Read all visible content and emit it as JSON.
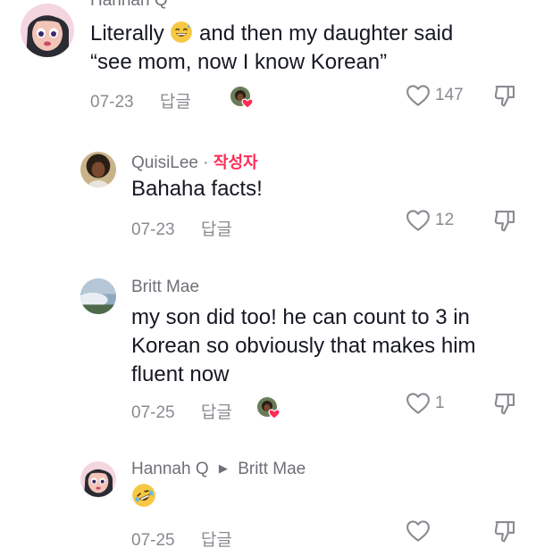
{
  "comments": [
    {
      "username": "Hannah Q",
      "text_prefix": "Literally",
      "text_suffix": "and then my daughter said",
      "text_line2": "“see mom, now I know Korean”",
      "date": "07-23",
      "reply_label": "답글",
      "likes": "147",
      "creator_liked": true
    },
    {
      "username": "QuisiLee",
      "separator": "·",
      "author_badge": "작성자",
      "text": "Bahaha facts!",
      "date": "07-23",
      "reply_label": "답글",
      "likes": "12",
      "creator_liked": false
    },
    {
      "username": "Britt Mae",
      "text_line1": "my son did too! he can count to 3 in",
      "text_line2": "Korean so obviously that makes him",
      "text_line3": "fluent now",
      "date": "07-25",
      "reply_label": "답글",
      "likes": "1",
      "creator_liked": true
    },
    {
      "username": "Hannah Q",
      "reply_to": "Britt Mae",
      "date": "07-25",
      "reply_label": "답글",
      "likes": "",
      "creator_liked": false
    }
  ],
  "colors": {
    "heart_red": "#fe2c55",
    "meta_gray": "#8a8b91",
    "text_dark": "#161823",
    "emoji_yellow": "#f7c843"
  }
}
